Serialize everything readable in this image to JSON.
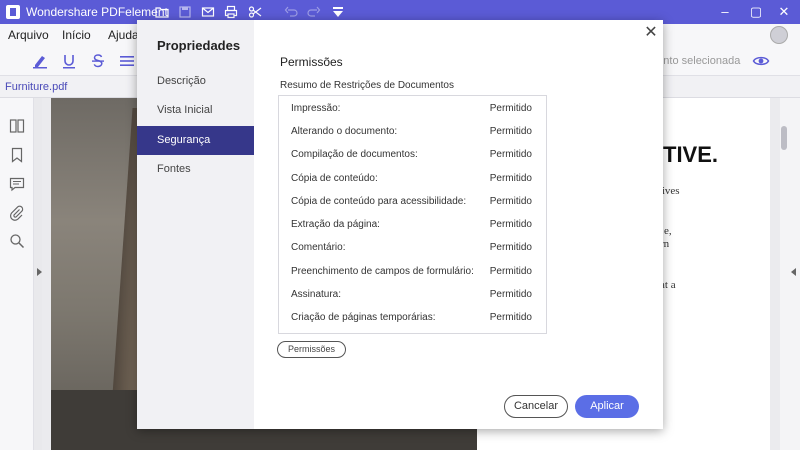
{
  "app": {
    "title": "Wondershare PDFelement"
  },
  "menu": {
    "items": [
      "Arquivo",
      "Início",
      "Ajuda"
    ]
  },
  "toolbar": {
    "selection_hint": "mento selecionada"
  },
  "file_tab": {
    "name": "Furniture.pdf"
  },
  "document": {
    "heading": "TIVE.",
    "lines": [
      "eatives",
      "e,",
      "rn",
      "at a"
    ]
  },
  "dialog": {
    "title": "Propriedades",
    "nav": [
      {
        "label": "Descrição",
        "active": false
      },
      {
        "label": "Vista Inicial",
        "active": false
      },
      {
        "label": "Segurança",
        "active": true
      },
      {
        "label": "Fontes",
        "active": false
      }
    ],
    "section_title": "Permissões",
    "summary_label": "Resumo de Restrições de Documentos",
    "permissions": [
      {
        "name": "Impressão:",
        "value": "Permitido"
      },
      {
        "name": "Alterando o documento:",
        "value": "Permitido"
      },
      {
        "name": "Compilação de documentos:",
        "value": "Permitido"
      },
      {
        "name": "Cópia de conteúdo:",
        "value": "Permitido"
      },
      {
        "name": "Cópia de conteúdo para acessibilidade:",
        "value": "Permitido"
      },
      {
        "name": "Extração da página:",
        "value": "Permitido"
      },
      {
        "name": "Comentário:",
        "value": "Permitido"
      },
      {
        "name": "Preenchimento de campos de formulário:",
        "value": "Permitido"
      },
      {
        "name": "Assinatura:",
        "value": "Permitido"
      },
      {
        "name": "Criação de páginas temporárias:",
        "value": "Permitido"
      }
    ],
    "permissions_button": "Permissões",
    "cancel_button": "Cancelar",
    "apply_button": "Aplicar"
  },
  "colors": {
    "accent": "#5b5bd6",
    "nav_active": "#36378a",
    "apply": "#5b6ee6"
  }
}
